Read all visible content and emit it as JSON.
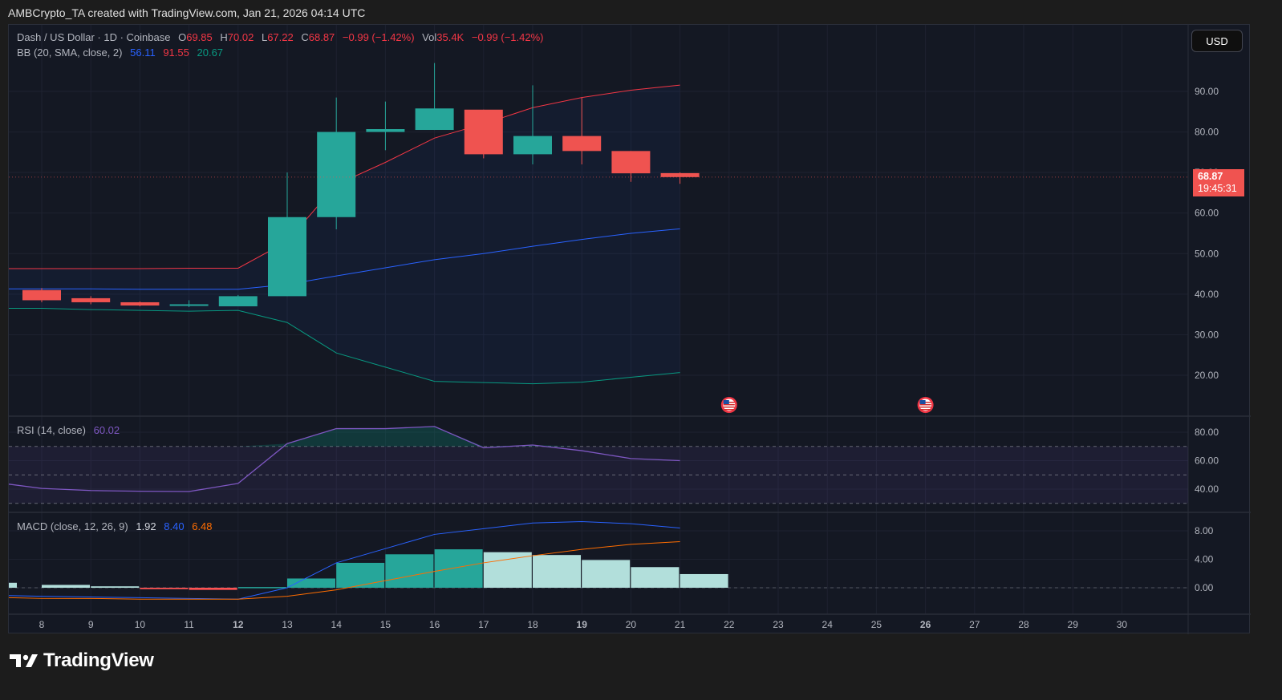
{
  "credit": "AMBCrypto_TA created with TradingView.com, Jan 21, 2026 04:14 UTC",
  "legend": {
    "symbol": "Dash / US Dollar · 1D · Coinbase",
    "o_label": "O",
    "o": "69.85",
    "h_label": "H",
    "h": "70.02",
    "l_label": "L",
    "l": "67.22",
    "c_label": "C",
    "c": "68.87",
    "change": "−0.99 (−1.42%)",
    "vol_label": "Vol",
    "vol": "35.4K",
    "vol_change": "−0.99 (−1.42%)",
    "bb": "BB (20, SMA, close, 2)",
    "bb_basis": "56.11",
    "bb_upper": "91.55",
    "bb_lower": "20.67",
    "rsi": "RSI (14, close)",
    "rsi_value": "60.02",
    "macd": "MACD (close, 12, 26, 9)",
    "macd_hist": "1.92",
    "macd_line": "8.40",
    "macd_signal": "6.48"
  },
  "currency_button": "USD",
  "price_label": {
    "price": "68.87",
    "countdown": "19:45:31"
  },
  "brand": "TradingView",
  "colors": {
    "up": "#26a69a",
    "down": "#ef5350",
    "bb_upper": "#f23645",
    "bb_basis": "#2962ff",
    "bb_lower": "#089981",
    "rsi": "#7e57c2",
    "macd": "#2962ff",
    "signal": "#ff6d00"
  },
  "chart_data": [
    {
      "type": "candlestick",
      "x": [
        8,
        9,
        10,
        11,
        12,
        13,
        14,
        15,
        16,
        17,
        18,
        19,
        20,
        21
      ],
      "open": [
        41,
        39,
        38,
        37.3,
        37,
        39.5,
        59,
        80,
        80.5,
        85.5,
        74.5,
        79,
        75.3,
        69.85
      ],
      "high": [
        41.5,
        39.5,
        38.2,
        38.5,
        39.8,
        70,
        88.5,
        87.5,
        97,
        85.5,
        91.5,
        88.5,
        75.3,
        70.02
      ],
      "low": [
        38,
        37.5,
        37,
        36.8,
        37,
        39.5,
        56,
        75.5,
        80.5,
        73.5,
        72,
        72,
        67.7,
        67.22
      ],
      "close": [
        38.5,
        38,
        37.2,
        37.5,
        39.5,
        59,
        80,
        80.7,
        85.8,
        74.5,
        79,
        75.3,
        69.8,
        68.87
      ],
      "bb_upper": [
        46.3,
        46.3,
        46.3,
        46.4,
        46.4,
        53,
        67,
        72.5,
        78.5,
        82,
        86,
        88.5,
        90.3,
        91.55
      ],
      "bb_basis": [
        41.3,
        41.3,
        41.2,
        41.2,
        41.2,
        42.4,
        44.5,
        46.5,
        48.5,
        50,
        51.8,
        53.5,
        55,
        56.11
      ],
      "bb_lower": [
        36.5,
        36.2,
        36,
        35.8,
        36,
        33,
        25.5,
        22,
        18.5,
        18.2,
        17.9,
        18.3,
        19.5,
        20.67
      ],
      "y_ticks": [
        "90.00",
        "80.00",
        "70.00",
        "60.00",
        "50.00",
        "40.00",
        "30.00",
        "20.00"
      ],
      "ylim": [
        13,
        105
      ],
      "event_flags_x": [
        22,
        26
      ]
    },
    {
      "type": "line",
      "name": "RSI (14, close)",
      "x": [
        8,
        9,
        10,
        11,
        12,
        13,
        14,
        15,
        16,
        17,
        18,
        19,
        20,
        21
      ],
      "values": [
        40.5,
        39,
        38.5,
        38.3,
        44,
        72,
        82.5,
        82.5,
        84,
        69,
        71,
        67,
        61.5,
        60.02
      ],
      "bands": [
        70,
        50,
        30
      ],
      "y_ticks": [
        "80.00",
        "60.00",
        "40.00"
      ],
      "ylim": [
        26,
        93
      ]
    },
    {
      "type": "bar+line",
      "name": "MACD (close, 12, 26, 9)",
      "x": [
        8,
        9,
        10,
        11,
        12,
        13,
        14,
        15,
        16,
        17,
        18,
        19,
        20,
        21
      ],
      "histogram": [
        0.4,
        0.2,
        -0.2,
        -0.3,
        0.1,
        1.3,
        3.5,
        4.7,
        5.4,
        5.0,
        4.6,
        3.9,
        2.9,
        1.92
      ],
      "macd": [
        -1.2,
        -1.3,
        -1.4,
        -1.5,
        -1.6,
        0,
        3.5,
        5.5,
        7.5,
        8.3,
        9.1,
        9.3,
        9,
        8.4
      ],
      "signal": [
        -1.5,
        -1.5,
        -1.6,
        -1.6,
        -1.6,
        -1.2,
        -0.3,
        1,
        2.3,
        3.5,
        4.5,
        5.4,
        6.1,
        6.48
      ],
      "y_ticks": [
        "8.00",
        "4.00",
        "0.00"
      ],
      "ylim": [
        -3,
        10.5
      ]
    }
  ],
  "x_ticks": [
    "8",
    "9",
    "10",
    "11",
    "12",
    "13",
    "14",
    "15",
    "16",
    "17",
    "18",
    "19",
    "20",
    "21",
    "22",
    "23",
    "24",
    "25",
    "26",
    "27",
    "28",
    "29",
    "30"
  ],
  "x_ticks_bold": [
    "12",
    "19",
    "26"
  ]
}
